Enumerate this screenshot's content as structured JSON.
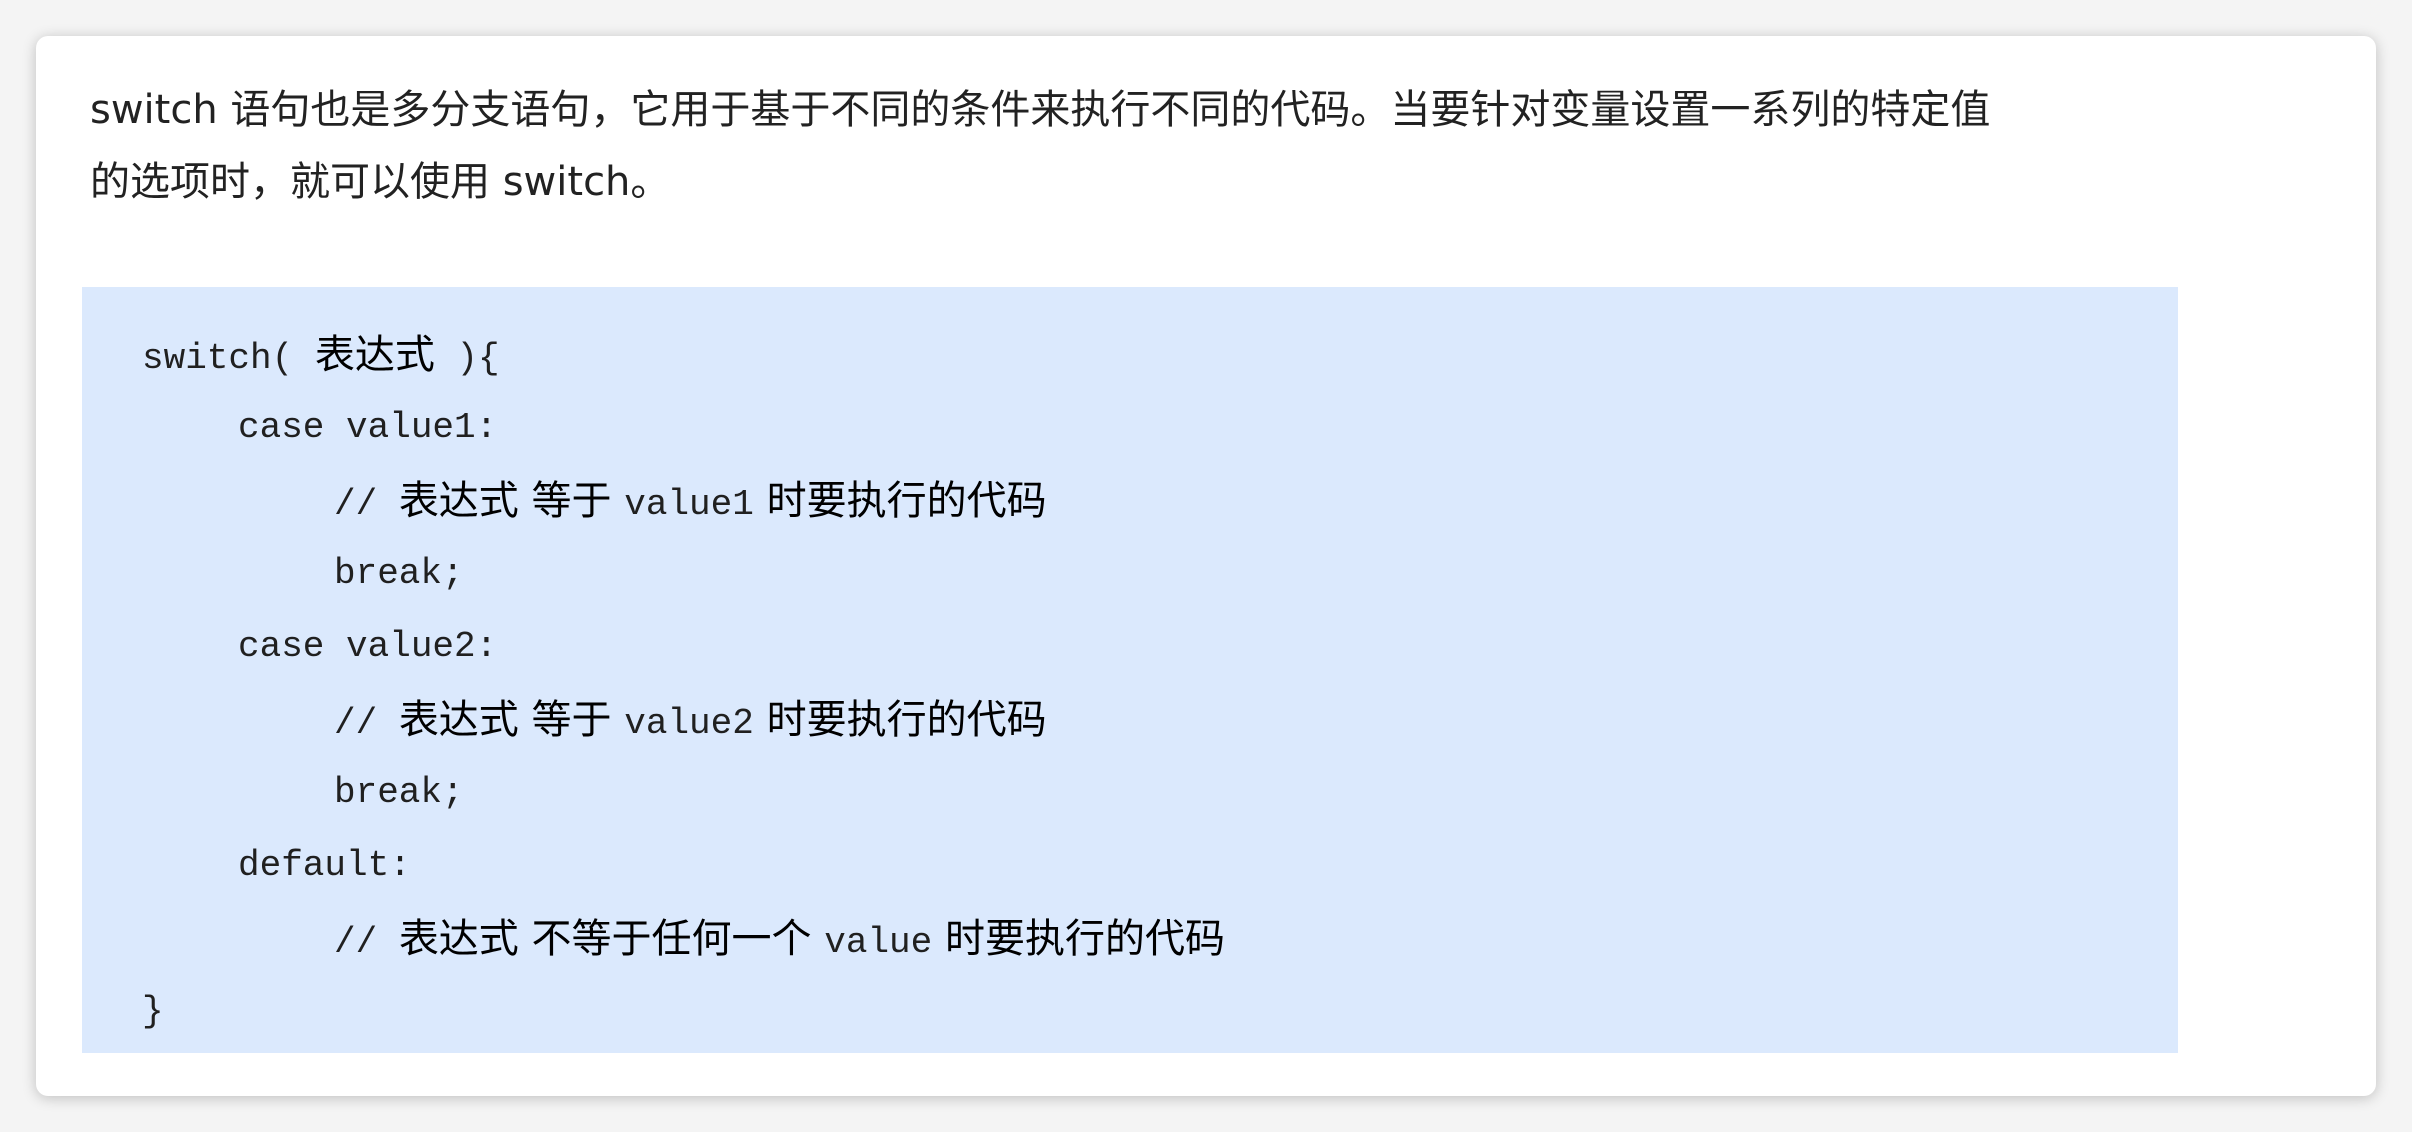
{
  "intro": {
    "line1": "switch 语句也是多分支语句，它用于基于不同的条件来执行不同的代码。当要针对变量设置一系列的特定值",
    "line2": "的选项时，就可以使用 switch。"
  },
  "code": {
    "line1_kw": "switch( ",
    "line1_expr": "表达式",
    "line1_end": " ){",
    "line2": "case value1:",
    "line3_comment": "// ",
    "line3_expr": "表达式",
    "line3_eq": " 等于 ",
    "line3_val": "value1",
    "line3_tail": " 时要执行的代码",
    "line4": "break;",
    "line5": "case value2:",
    "line6_comment": "// ",
    "line6_expr": "表达式",
    "line6_eq": " 等于 ",
    "line6_val": "value2",
    "line6_tail": " 时要执行的代码",
    "line7": "break;",
    "line8": "default:",
    "line9_comment": "// ",
    "line9_expr": "表达式",
    "line9_neq": " 不等于任何一个 ",
    "line9_val": "value",
    "line9_tail": " 时要执行的代码",
    "line10": "}"
  },
  "colors": {
    "code_background": "#dbe9fd",
    "text": "#222222"
  }
}
